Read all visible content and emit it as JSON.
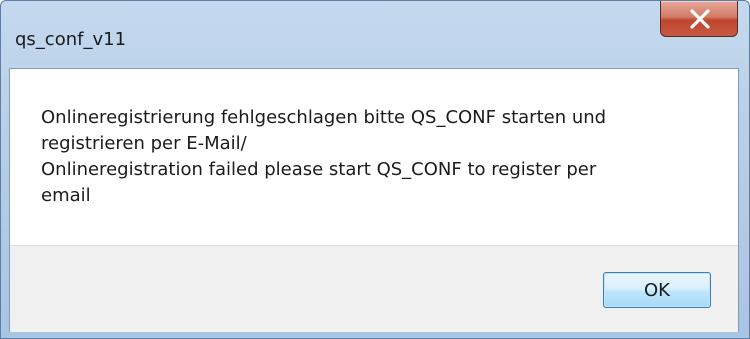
{
  "window": {
    "title": "qs_conf_v11",
    "close_icon": "close-icon"
  },
  "message": {
    "lines": [
      "Onlineregistrierung fehlgeschlagen bitte QS_CONF starten und",
      "registrieren per E-Mail/",
      "Onlineregistration failed please start QS_CONF to register per",
      "email"
    ]
  },
  "buttons": {
    "ok_label": "OK"
  },
  "colors": {
    "close_button": "#c0452d",
    "frame": "#b7cfe8",
    "ok_border": "#3c7fb1"
  }
}
